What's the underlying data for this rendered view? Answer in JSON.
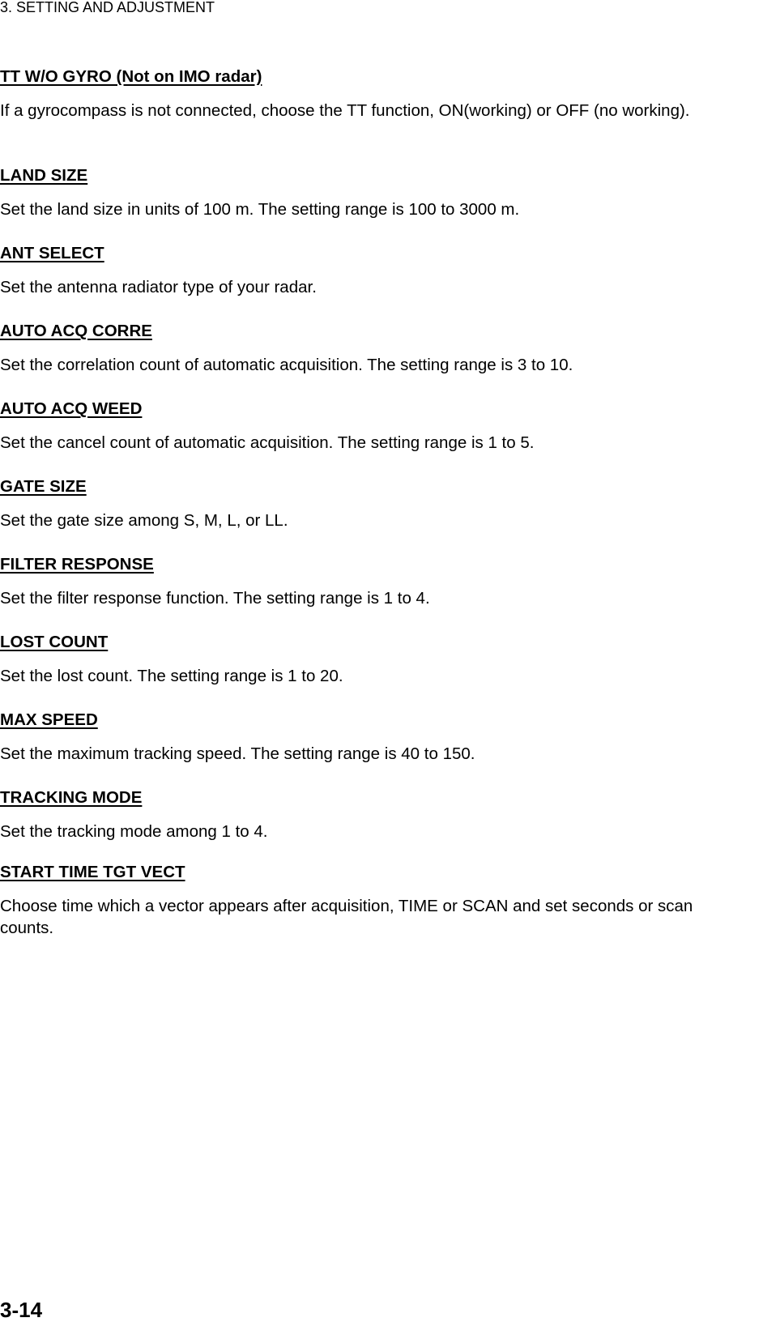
{
  "running_head": "3. SETTING AND ADJUSTMENT",
  "sections": [
    {
      "heading": "TT W/O GYRO (Not on IMO radar)",
      "body": "If a gyrocompass is not connected, choose the TT function, ON(working) or OFF (no working)."
    },
    {
      "heading": "LAND SIZE",
      "body": "Set the land size in units of 100 m. The setting range is 100 to 3000 m."
    },
    {
      "heading": "ANT SELECT",
      "body": "Set the antenna radiator type of your radar."
    },
    {
      "heading": "AUTO ACQ CORRE",
      "body": "Set the correlation count of automatic acquisition. The setting range is 3 to 10."
    },
    {
      "heading": "AUTO ACQ WEED",
      "body": "Set the cancel count of automatic acquisition. The setting range is 1 to 5."
    },
    {
      "heading": "GATE SIZE",
      "body": "Set the gate size among S, M, L, or LL."
    },
    {
      "heading": "FILTER RESPONSE",
      "body": "Set the filter response function. The setting range is 1 to 4."
    },
    {
      "heading": "LOST COUNT",
      "body": "Set the lost count. The setting range is 1 to 20."
    },
    {
      "heading": "MAX SPEED",
      "body": "Set the maximum tracking speed. The setting range is 40 to 150."
    },
    {
      "heading": "TRACKING MODE",
      "body": "Set the tracking mode among 1 to 4."
    },
    {
      "heading": "START TIME TGT VECT",
      "body": "Choose time which a vector appears after acquisition, TIME or SCAN and set seconds or scan counts."
    }
  ],
  "page_number": "3-14"
}
